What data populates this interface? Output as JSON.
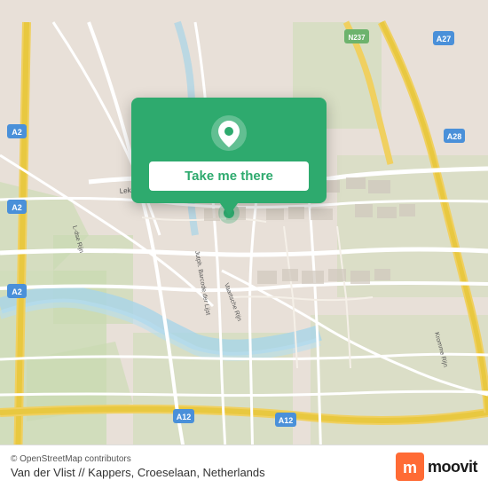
{
  "map": {
    "background_color": "#e8e0d8",
    "center_lat": 52.08,
    "center_lng": 5.12
  },
  "popup": {
    "button_label": "Take me there",
    "bg_color": "#2eaa6e"
  },
  "bottom_bar": {
    "attribution": "© OpenStreetMap contributors",
    "location_name": "Van der Vlist // Kappers, Croeselaan, Netherlands",
    "moovit_label": "moovit"
  }
}
